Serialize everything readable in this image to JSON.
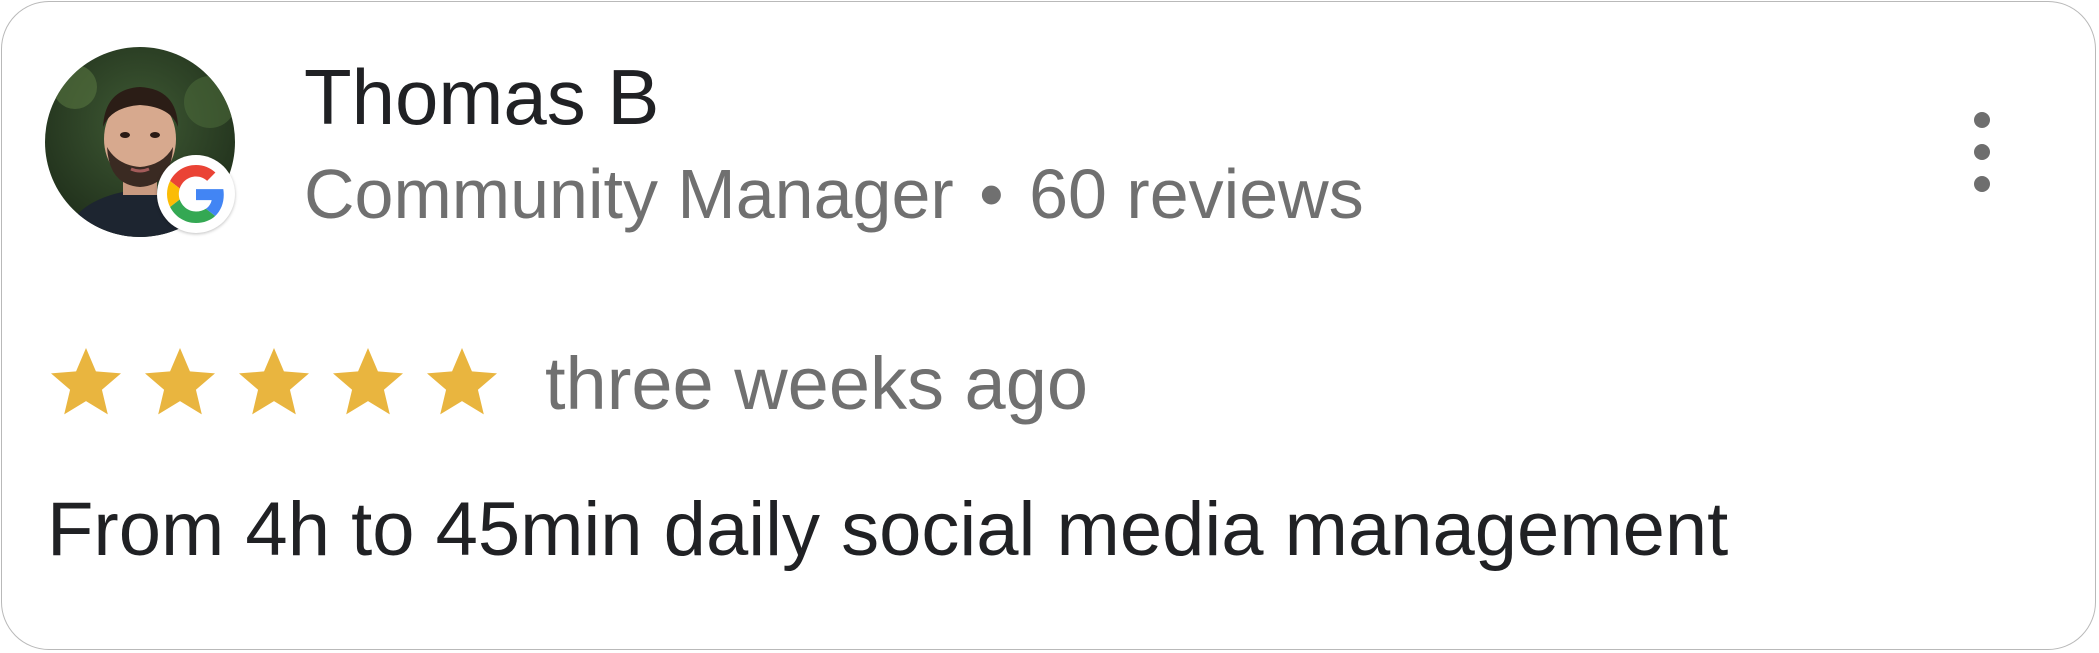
{
  "reviewer": {
    "name": "Thomas B",
    "role": "Community Manager",
    "separator": "•",
    "review_count": "60 reviews",
    "avatar_icon": "person-photo",
    "badge_icon": "google-g-icon"
  },
  "review": {
    "rating": 5,
    "max_rating": 5,
    "time_ago": "three weeks ago",
    "text": "From 4h to 45min daily social media management"
  },
  "menu": {
    "icon": "more-vertical-icon"
  },
  "colors": {
    "star": "#E9B53F",
    "primary_text": "#202124",
    "secondary_text": "#707070",
    "border": "#B9B9B9",
    "google_blue": "#4285F4",
    "google_red": "#EA4335",
    "google_yellow": "#FBBC05",
    "google_green": "#34A853"
  }
}
